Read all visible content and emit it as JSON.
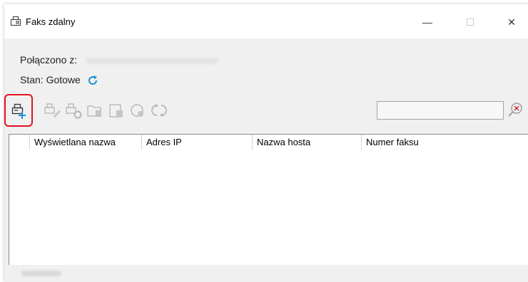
{
  "window": {
    "title": "Faks zdalny",
    "min_glyph": "—",
    "max_glyph": "☐",
    "close_glyph": "✕"
  },
  "info": {
    "connected_label": "Połączono z:",
    "state_label": "Stan:",
    "state_value": "Gotowe"
  },
  "toolbar": {
    "icons": [
      "add-fax-icon",
      "edit-fax-icon",
      "fax-settings-icon",
      "fax-folder-icon",
      "fax-list-icon",
      "fax-download-icon",
      "sync-icon"
    ],
    "search_placeholder": ""
  },
  "table": {
    "columns": [
      "",
      "Wyświetlana nazwa",
      "Adres IP",
      "Nazwa hosta",
      "Numer faksu"
    ],
    "rows": []
  },
  "colors": {
    "accent": "#1a8fd6",
    "highlight": "#e1141f"
  }
}
